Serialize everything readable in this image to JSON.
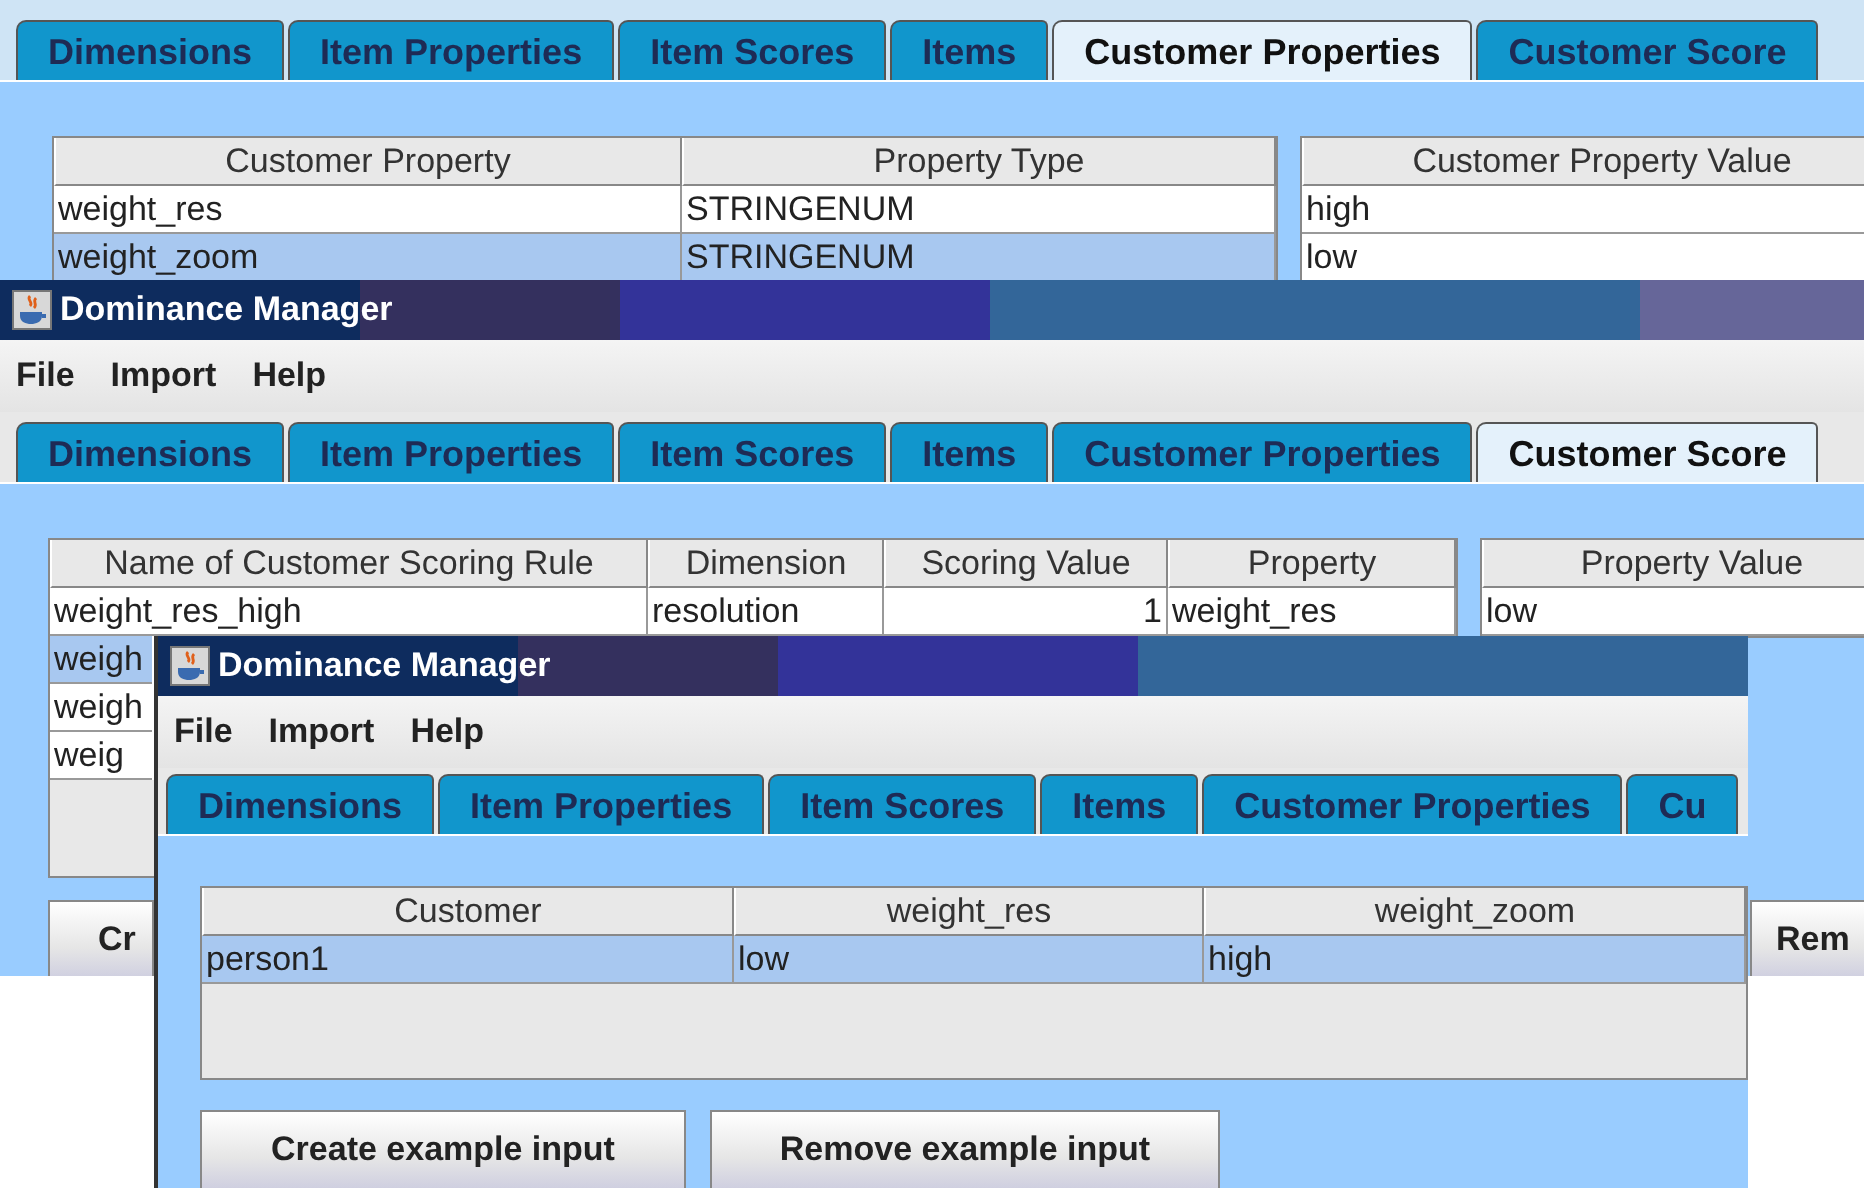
{
  "windows": [
    {
      "tabs": [
        {
          "label": "Dimensions",
          "selected": false
        },
        {
          "label": "Item Properties",
          "selected": false
        },
        {
          "label": "Item Scores",
          "selected": false
        },
        {
          "label": "Items",
          "selected": false
        },
        {
          "label": "Customer Properties",
          "selected": true
        },
        {
          "label": "Customer Score",
          "selected": false
        }
      ],
      "tables": [
        {
          "columns": [
            {
              "label": "Customer Property",
              "kind": "text"
            },
            {
              "label": "Property Type",
              "kind": "text"
            }
          ],
          "rows": [
            {
              "cells": [
                "weight_res",
                "STRINGENUM"
              ],
              "selected": false
            },
            {
              "cells": [
                "weight_zoom",
                "STRINGENUM"
              ],
              "selected": true
            }
          ]
        },
        {
          "columns": [
            {
              "label": "Customer Property Value",
              "kind": "text"
            }
          ],
          "rows": [
            {
              "cells": [
                "high"
              ],
              "selected": false
            },
            {
              "cells": [
                "low"
              ],
              "selected": false
            }
          ]
        }
      ]
    },
    {
      "title": "Dominance Manager",
      "menu": [
        "File",
        "Import",
        "Help"
      ],
      "tabs": [
        {
          "label": "Dimensions",
          "selected": false
        },
        {
          "label": "Item Properties",
          "selected": false
        },
        {
          "label": "Item Scores",
          "selected": false
        },
        {
          "label": "Items",
          "selected": false
        },
        {
          "label": "Customer Properties",
          "selected": false
        },
        {
          "label": "Customer Score",
          "selected": true
        }
      ],
      "tables": [
        {
          "columns": [
            {
              "label": "Name of Customer Scoring Rule",
              "kind": "text"
            },
            {
              "label": "Dimension",
              "kind": "text"
            },
            {
              "label": "Scoring Value",
              "kind": "number"
            },
            {
              "label": "Property",
              "kind": "text"
            }
          ],
          "rows": [
            {
              "cells": [
                "weight_res_high",
                "resolution",
                "1",
                "weight_res"
              ],
              "selected": false
            },
            {
              "cells": [
                "weigh"
              ],
              "selected": true
            },
            {
              "cells": [
                "weigh"
              ],
              "selected": false
            },
            {
              "cells": [
                "weig"
              ],
              "selected": false
            }
          ]
        },
        {
          "columns": [
            {
              "label": "Property Value",
              "kind": "text"
            }
          ],
          "rows": [
            {
              "cells": [
                "low"
              ],
              "selected": false
            }
          ]
        }
      ],
      "buttons": [
        "Cr",
        "Rem"
      ]
    },
    {
      "title": "Dominance Manager",
      "menu": [
        "File",
        "Import",
        "Help"
      ],
      "tabs": [
        {
          "label": "Dimensions",
          "selected": false
        },
        {
          "label": "Item Properties",
          "selected": false
        },
        {
          "label": "Item Scores",
          "selected": false
        },
        {
          "label": "Items",
          "selected": false
        },
        {
          "label": "Customer Properties",
          "selected": false
        },
        {
          "label": "Cu",
          "selected": false
        }
      ],
      "tables": [
        {
          "columns": [
            {
              "label": "Customer",
              "kind": "text"
            },
            {
              "label": "weight_res",
              "kind": "text"
            },
            {
              "label": "weight_zoom",
              "kind": "text"
            }
          ],
          "rows": [
            {
              "cells": [
                "person1",
                "low",
                "high"
              ],
              "selected": true
            }
          ]
        }
      ],
      "buttons": [
        "Create example input",
        "Remove example input"
      ]
    }
  ]
}
